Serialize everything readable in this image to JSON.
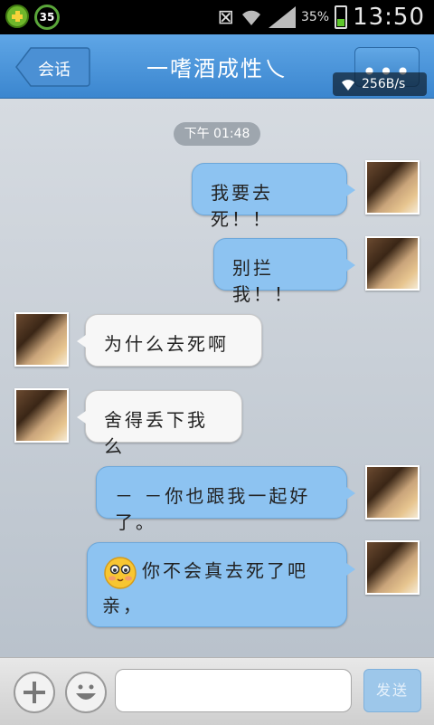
{
  "status_bar": {
    "notif_badge": "35",
    "battery_percent": "35%",
    "time": "13:50",
    "icons": [
      "app-plus-icon",
      "timer-35-icon",
      "vibrate-icon",
      "wifi-icon",
      "signal-icon",
      "battery-icon"
    ]
  },
  "header": {
    "back_label": "会话",
    "title": "一嗜酒成性乀",
    "more_label": "•••",
    "net_speed": "256B/s"
  },
  "chat": {
    "timestamp": "下午 01:48",
    "messages": [
      {
        "side": "out",
        "text": "我要去死！！"
      },
      {
        "side": "out",
        "text": "别拦我！！"
      },
      {
        "side": "in",
        "text": "为什么去死啊"
      },
      {
        "side": "in",
        "text": "舍得丢下我么"
      },
      {
        "side": "out",
        "text": "－ －你也跟我一起好了。"
      },
      {
        "side": "out",
        "text": "你不会真去死了吧",
        "text2": "亲，",
        "emoji": "blushing-face-emoji"
      }
    ]
  },
  "input_bar": {
    "input_value": "",
    "send_label": "发送"
  },
  "colors": {
    "header": "#4a95db",
    "bubble_out": "#8dc3f1",
    "bubble_in": "#f7f7f7",
    "send_button": "#9dc7ea"
  }
}
